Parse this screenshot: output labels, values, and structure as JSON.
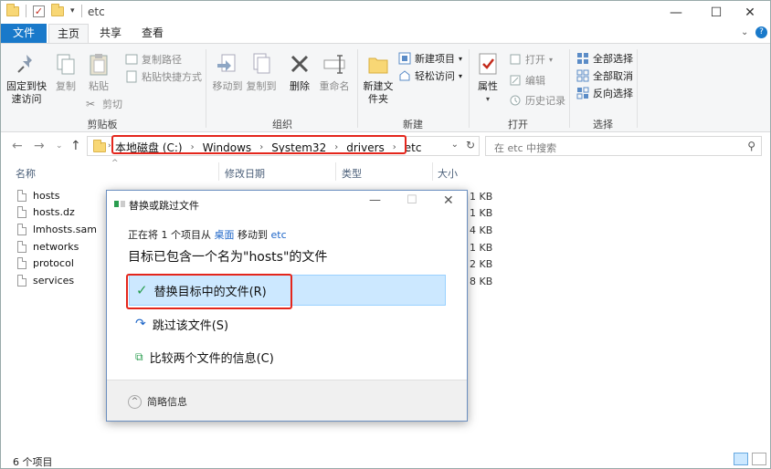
{
  "window": {
    "title": "etc"
  },
  "window_controls": {
    "minimize": "—",
    "maximize": "☐",
    "close": "✕"
  },
  "ribbon_tabs": {
    "file": "文件",
    "home": "主页",
    "share": "共享",
    "view": "查看"
  },
  "ribbon": {
    "clipboard": {
      "label": "剪贴板",
      "pin": "固定到快速访问",
      "copy": "复制",
      "paste": "粘贴",
      "copy_path": "复制路径",
      "paste_shortcut": "粘贴快捷方式",
      "cut": "剪切"
    },
    "organize": {
      "label": "组织",
      "move_to": "移动到",
      "copy_to": "复制到",
      "delete": "删除",
      "rename": "重命名"
    },
    "new": {
      "label": "新建",
      "new_folder": "新建文件夹",
      "new_item": "新建项目",
      "easy_access": "轻松访问"
    },
    "open": {
      "label": "打开",
      "properties": "属性",
      "open": "打开",
      "edit": "编辑",
      "history": "历史记录"
    },
    "select": {
      "label": "选择",
      "select_all": "全部选择",
      "select_none": "全部取消",
      "invert": "反向选择"
    }
  },
  "address": {
    "crumbs": [
      "本地磁盘 (C:)",
      "Windows",
      "System32",
      "drivers",
      "etc"
    ],
    "search_placeholder": "在 etc 中搜索"
  },
  "columns": {
    "name": "名称",
    "modified": "修改日期",
    "type": "类型",
    "size": "大小"
  },
  "files": [
    {
      "name": "hosts",
      "size": "1 KB"
    },
    {
      "name": "hosts.dz",
      "size": "1 KB"
    },
    {
      "name": "lmhosts.sam",
      "size": "4 KB"
    },
    {
      "name": "networks",
      "size": "1 KB"
    },
    {
      "name": "protocol",
      "size": "2 KB"
    },
    {
      "name": "services",
      "size": "8 KB"
    }
  ],
  "status": {
    "count": "6 个项目"
  },
  "dialog": {
    "title": "替换或跳过文件",
    "line_prefix": "正在将 1 个项目从",
    "source": "桌面",
    "line_mid": "移动到",
    "dest": "etc",
    "heading": "目标已包含一个名为\"hosts\"的文件",
    "options": {
      "replace": "替换目标中的文件(R)",
      "skip": "跳过该文件(S)",
      "compare": "比较两个文件的信息(C)"
    },
    "more_info": "简略信息"
  }
}
